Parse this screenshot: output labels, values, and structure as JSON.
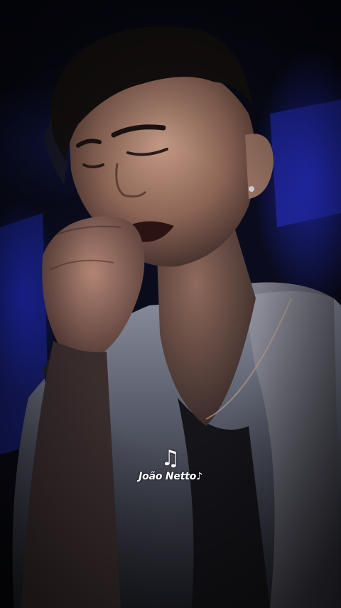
{
  "scene": {
    "description_icon": "music-notes-icon",
    "background_accent": "#2a35d8",
    "background_dark": "#070812"
  },
  "watermark": {
    "icon": "♫",
    "text": "João Netto♪"
  }
}
